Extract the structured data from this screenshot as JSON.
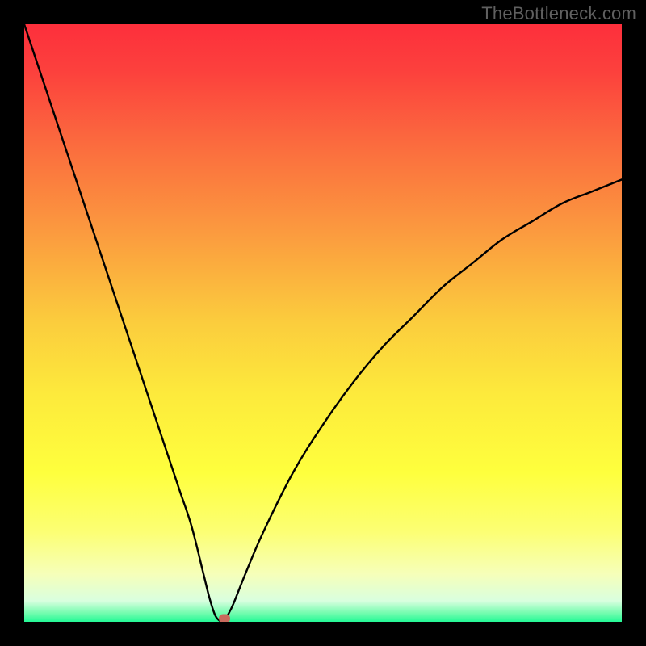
{
  "watermark": "TheBottleneck.com",
  "chart_data": {
    "type": "line",
    "title": "",
    "xlabel": "",
    "ylabel": "",
    "xlim": [
      0,
      100
    ],
    "ylim": [
      0,
      100
    ],
    "grid": false,
    "series": [
      {
        "name": "bottleneck-curve",
        "x": [
          0,
          2,
          4,
          6,
          8,
          10,
          12,
          14,
          16,
          18,
          20,
          22,
          24,
          26,
          28,
          30,
          31,
          32,
          33,
          33.5,
          34,
          35,
          37,
          40,
          45,
          50,
          55,
          60,
          65,
          70,
          75,
          80,
          85,
          90,
          95,
          100
        ],
        "y": [
          100,
          94,
          88,
          82,
          76,
          70,
          64,
          58,
          52,
          46,
          40,
          34,
          28,
          22,
          16,
          8,
          4,
          1,
          0,
          0,
          1,
          3,
          8,
          15,
          25,
          33,
          40,
          46,
          51,
          56,
          60,
          64,
          67,
          70,
          72,
          74
        ],
        "color": "#000000"
      }
    ],
    "gradient_stops": [
      {
        "pos": 0.0,
        "color": "#fd2f3c"
      },
      {
        "pos": 0.08,
        "color": "#fc413d"
      },
      {
        "pos": 0.2,
        "color": "#fb6b3e"
      },
      {
        "pos": 0.35,
        "color": "#fb9b3f"
      },
      {
        "pos": 0.5,
        "color": "#fbcd3d"
      },
      {
        "pos": 0.62,
        "color": "#fdea3c"
      },
      {
        "pos": 0.75,
        "color": "#feff3d"
      },
      {
        "pos": 0.85,
        "color": "#fcff74"
      },
      {
        "pos": 0.92,
        "color": "#f6ffb9"
      },
      {
        "pos": 0.965,
        "color": "#d9ffdf"
      },
      {
        "pos": 0.985,
        "color": "#76fcb0"
      },
      {
        "pos": 1.0,
        "color": "#24f996"
      }
    ],
    "marker": {
      "x": 33.5,
      "y": 0,
      "color": "#c96a5c"
    }
  }
}
